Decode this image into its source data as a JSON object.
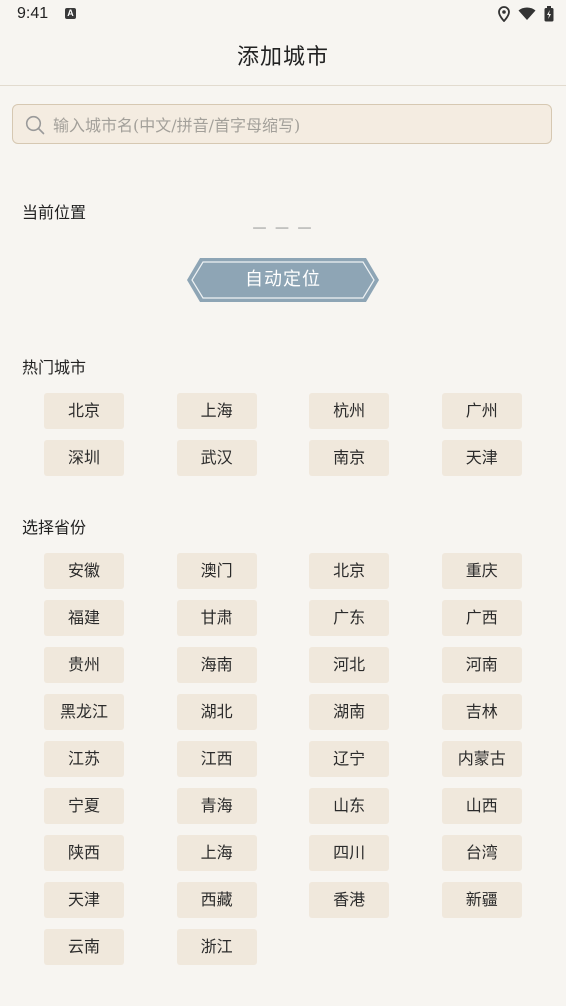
{
  "status_bar": {
    "time": "9:41",
    "a_badge": "A",
    "icons": [
      "location-icon",
      "wifi-icon",
      "battery-icon"
    ]
  },
  "header": {
    "title": "添加城市"
  },
  "search": {
    "placeholder": "输入城市名(中文/拼音/首字母缩写)"
  },
  "current_location": {
    "title": "当前位置",
    "value": "— — —",
    "button_label": "自动定位"
  },
  "hot_cities": {
    "title": "热门城市",
    "items": [
      "北京",
      "上海",
      "杭州",
      "广州",
      "深圳",
      "武汉",
      "南京",
      "天津"
    ]
  },
  "provinces": {
    "title": "选择省份",
    "items": [
      "安徽",
      "澳门",
      "北京",
      "重庆",
      "福建",
      "甘肃",
      "广东",
      "广西",
      "贵州",
      "海南",
      "河北",
      "河南",
      "黑龙江",
      "湖北",
      "湖南",
      "吉林",
      "江苏",
      "江西",
      "辽宁",
      "内蒙古",
      "宁夏",
      "青海",
      "山东",
      "山西",
      "陕西",
      "上海",
      "四川",
      "台湾",
      "天津",
      "西藏",
      "香港",
      "新疆",
      "云南",
      "浙江"
    ]
  },
  "colors": {
    "background": "#f7f5f1",
    "chip": "#f0e8dc",
    "accent": "#8ea5b5",
    "search_bg": "#f4ece1"
  }
}
